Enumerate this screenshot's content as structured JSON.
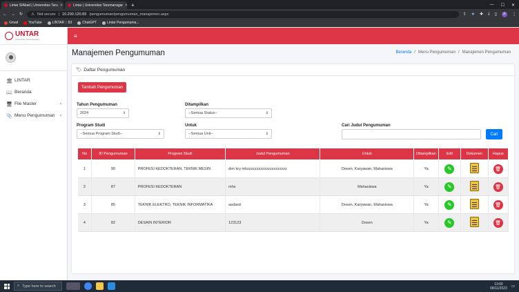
{
  "browser": {
    "tabs": [
      {
        "title": "Lintar SIAkad | Universitas Taru"
      },
      {
        "title": "Lintar | Universitas Tarumanagar"
      }
    ],
    "new_tab": "+",
    "url_security": "Not secure",
    "url_host": "10.200.120.83",
    "url_path": "/pengumuman/pengumuman_manajemen.aspx",
    "profile_initial": "P",
    "bookmarks": [
      {
        "label": "Gmail",
        "color": "#ea4335"
      },
      {
        "label": "YouTube",
        "color": "#ff0000"
      },
      {
        "label": "LINTAR :: 83",
        "color": "#bbbbbb"
      },
      {
        "label": "ChatGPT",
        "color": "#bbbbbb"
      },
      {
        "label": "Lintar Pengumuma...",
        "color": "#bbbbbb"
      }
    ]
  },
  "brand": {
    "name": "UNTAR",
    "subtitle": "Universitas Tarumanagara"
  },
  "sidebar": {
    "items": [
      {
        "label": "LINTAR",
        "icon": "institution-icon",
        "glyph": "🏛"
      },
      {
        "label": "Beranda",
        "icon": "book-icon",
        "glyph": "📖"
      },
      {
        "label": "File Master",
        "icon": "monitor-icon",
        "glyph": "🖥",
        "chevron": "‹"
      },
      {
        "label": "Menu Pengumuman",
        "icon": "paperclip-icon",
        "glyph": "📎",
        "chevron": "‹"
      }
    ]
  },
  "topbar": {
    "menu_glyph": "≡"
  },
  "page": {
    "title": "Manajemen Pengumuman",
    "breadcrumb": [
      "Beranda",
      "Menu Pengumuman",
      "Manajemen Pengumuman"
    ],
    "breadcrumb_sep": "/"
  },
  "card": {
    "header": "Daftar Pengumuman",
    "add_button": "Tambah Pengumuman"
  },
  "filters": {
    "tahun_label": "Tahun Pengumuman",
    "tahun_value": "2024",
    "ditampilkan_label": "Ditampilkan",
    "ditampilkan_value": "--Semua Status--",
    "prodi_label": "Program Studi",
    "prodi_value": "--Semua Program Studi--",
    "untuk_label": "Untuk",
    "untuk_value": "--Semua Unit--",
    "cari_label": "Cari Judul Pengumuman",
    "cari_value": "",
    "cari_button": "Cari"
  },
  "table": {
    "headers": [
      "No",
      "ID Pengumuman",
      "Program Studi",
      "Judul Pengumuman",
      "Untuk",
      "Ditampilkan",
      "Edit",
      "Dokumen",
      "Hapus"
    ],
    "rows": [
      {
        "no": "1",
        "id": "90",
        "prodi": "PROFESI KEDOKTERAN, TEKNIK MESIN",
        "judul": "dsn kry mhzzzzzzzzzzzzzzzzzzzzz",
        "untuk": "Dosen, Karyawan, Mahasiswa",
        "tampil": "Ya"
      },
      {
        "no": "2",
        "id": "87",
        "prodi": "PROFESI KEDOKTERAN",
        "judul": "mhs",
        "untuk": "Mahasiswa",
        "tampil": "Ya"
      },
      {
        "no": "3",
        "id": "85",
        "prodi": "TEKNIK ELEKTRO, TEKNIK INFORMATIKA",
        "judul": "asdasd",
        "untuk": "Dosen, Karyawan, Mahasiswa",
        "tampil": "Ya"
      },
      {
        "no": "4",
        "id": "82",
        "prodi": "DESAIN INTERIOR",
        "judul": "123123",
        "untuk": "Dosen",
        "tampil": "Ya"
      }
    ]
  },
  "taskbar": {
    "search_placeholder": "Type here to search",
    "time": "13:00",
    "date": "08/11/2023"
  },
  "colors": {
    "accent": "#dc3545",
    "primary": "#007bff",
    "edit": "#28c728"
  }
}
